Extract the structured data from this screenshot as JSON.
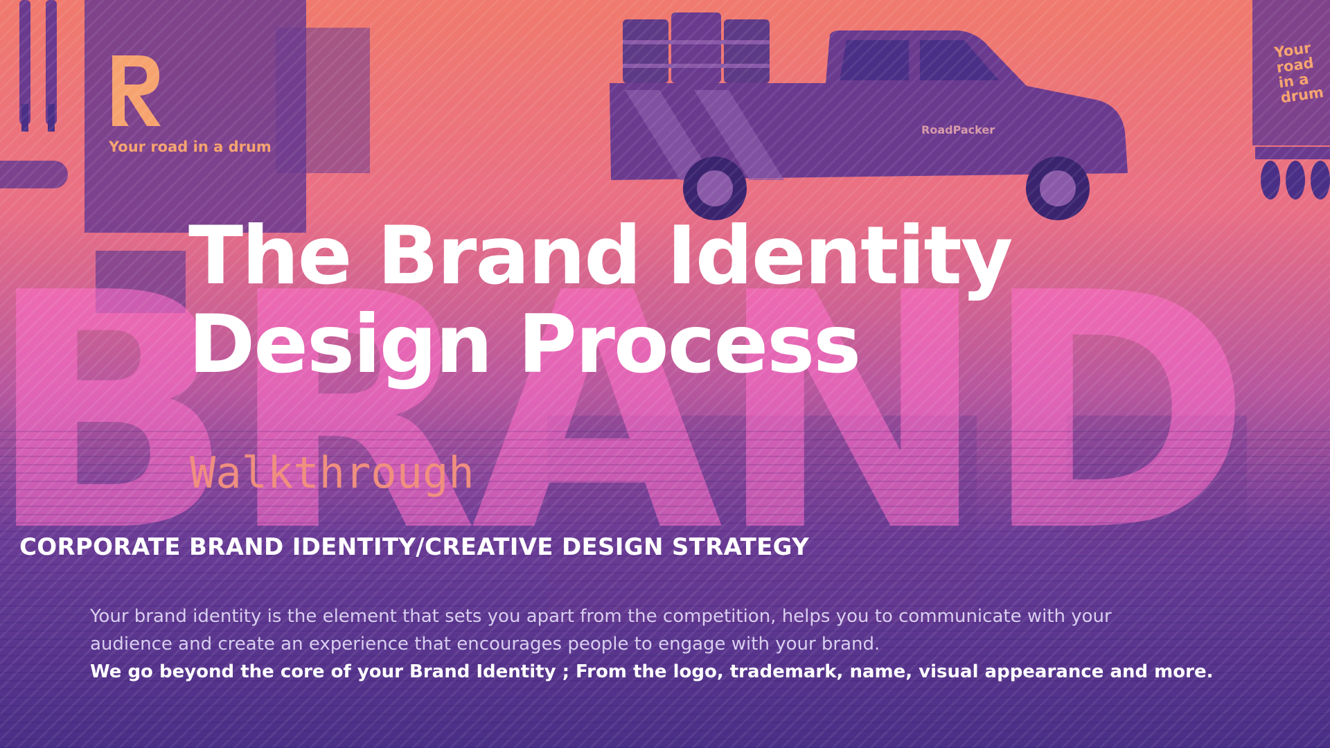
{
  "hero": {
    "title_line1": "The Brand Identity",
    "title_line2": "Design Process",
    "subtitle": "Walkthrough",
    "strategy": "CORPORATE BRAND IDENTITY/CREATIVE DESIGN STRATEGY",
    "description_line1": "Your brand identity is the element that sets you apart from the competition, helps you to communicate with your",
    "description_line2": "audience and create an experience that encourages people to engage with your brand.",
    "highlight": "We go beyond the core of your Brand Identity ; From the  logo, trademark, name, visual appearance and more."
  },
  "background": {
    "watermark": "BRAND",
    "stationery_tagline": "Your road in a drum",
    "truck_label": "RoadPacker",
    "trailer_text": "Your road in a drum"
  },
  "colors": {
    "gradient_top": "#f07a6d",
    "gradient_mid": "#b8579e",
    "gradient_bottom": "#4a2f86",
    "subtitle": "#f08f80",
    "watermark": "#ff6ec8",
    "title": "#ffffff"
  },
  "icons": [
    "r-logo-icon",
    "pickup-truck-icon",
    "drum-barrel-icon",
    "trailer-icon"
  ]
}
